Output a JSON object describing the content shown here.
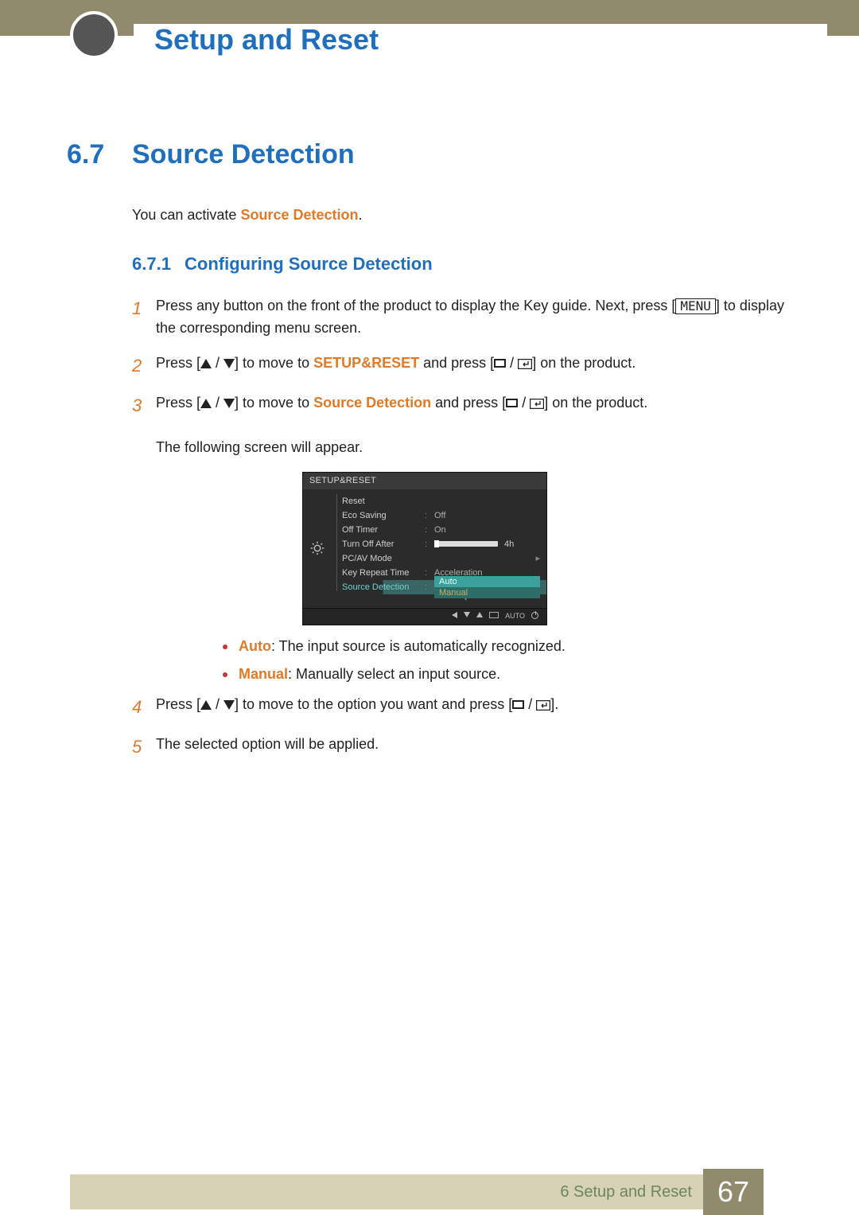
{
  "header": {
    "chapter_title": "Setup and Reset"
  },
  "section": {
    "number": "6.7",
    "title": "Source Detection"
  },
  "intro": {
    "pre": "You can activate ",
    "emph": "Source Detection",
    "post": "."
  },
  "subsection": {
    "number": "6.7.1",
    "title": "Configuring Source Detection"
  },
  "steps": {
    "s1": {
      "num": "1",
      "t1": "Press any button on the front of the product to display the Key guide. Next, press [",
      "menu": "MENU",
      "t2": "] to display the corresponding menu screen."
    },
    "s2": {
      "num": "2",
      "t1": "Press [",
      "t2": "] to move to ",
      "emph": "SETUP&RESET",
      "t3": " and press [",
      "t4": "] on the product."
    },
    "s3": {
      "num": "3",
      "t1": "Press [",
      "t2": "] to move to ",
      "emph": "Source Detection",
      "t3": " and press [",
      "t4": "] on the product.",
      "after": "The following screen will appear."
    },
    "s4": {
      "num": "4",
      "t1": "Press [",
      "t2": "] to move to the option you want and press [",
      "t3": "]."
    },
    "s5": {
      "num": "5",
      "text": "The selected option will be applied."
    }
  },
  "osd": {
    "title": "SETUP&RESET",
    "rows": {
      "reset": "Reset",
      "eco": "Eco Saving",
      "eco_val": "Off",
      "offtimer": "Off Timer",
      "offtimer_val": "On",
      "turnoff": "Turn Off After",
      "turnoff_val": "4h",
      "pcav": "PC/AV Mode",
      "keyrep": "Key Repeat Time",
      "keyrep_val": "Acceleration",
      "srcdet": "Source Detection",
      "srcdet_cur": "Auto",
      "srcdet_other": "Manual"
    },
    "foot": {
      "auto": "AUTO"
    }
  },
  "bullets": {
    "auto_label": "Auto",
    "auto_text": ": The input source is automatically recognized.",
    "manual_label": "Manual",
    "manual_text": ": Manually select an input source."
  },
  "footer": {
    "chapter": "6 Setup and Reset",
    "page": "67"
  }
}
